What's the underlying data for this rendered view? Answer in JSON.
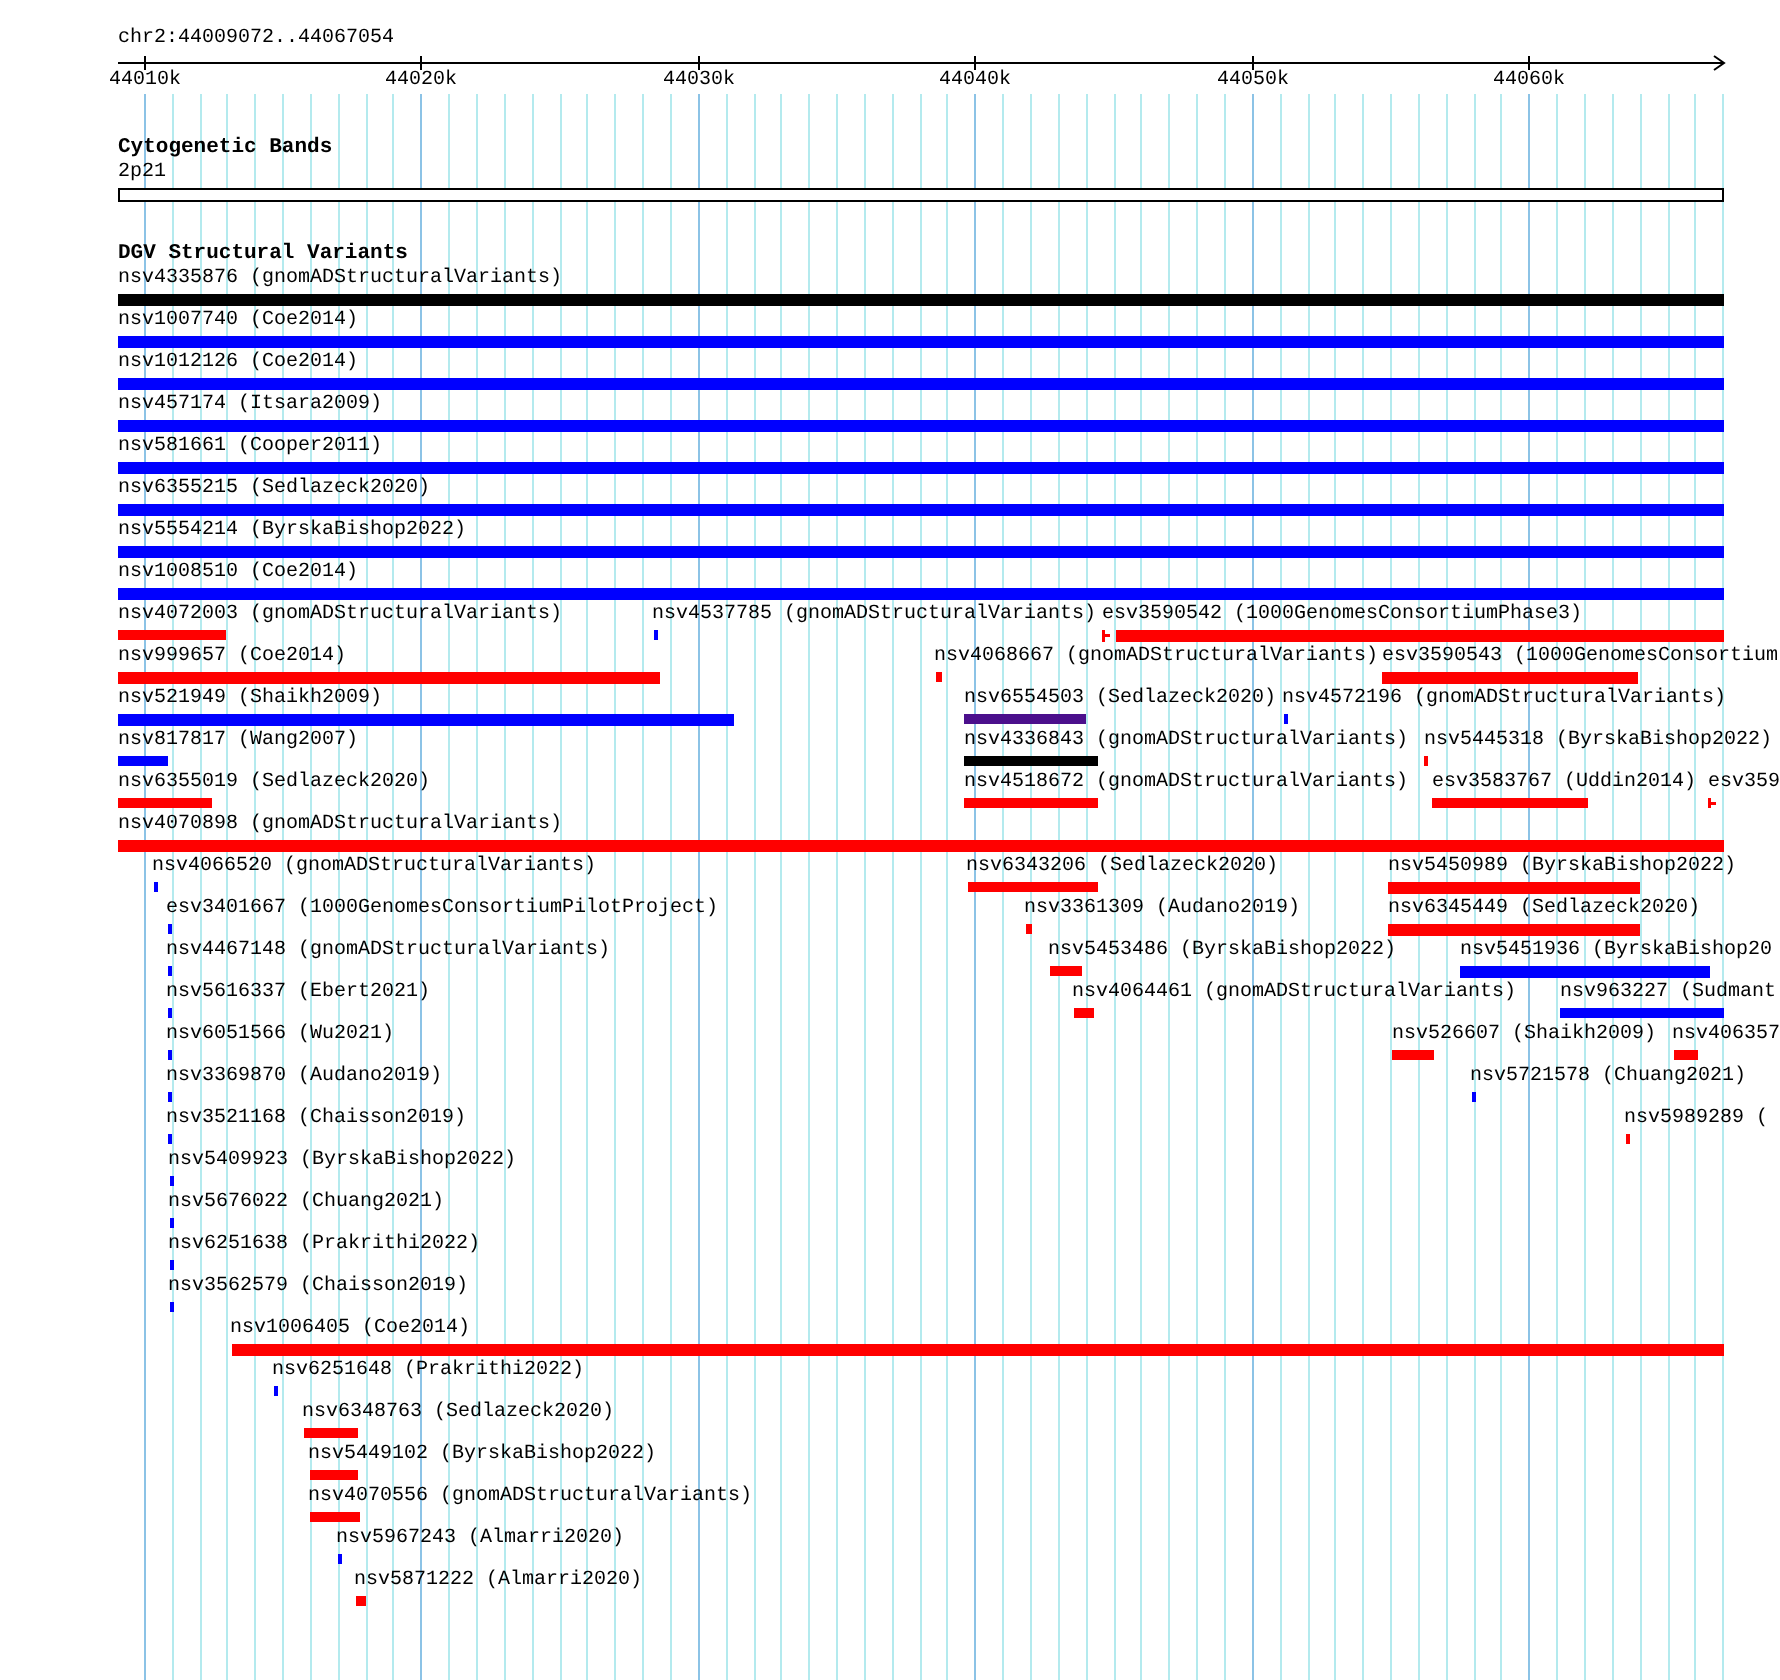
{
  "ruler": {
    "location": "chr2:44009072..44067054",
    "ticks": [
      "44010k",
      "44020k",
      "44030k",
      "44040k",
      "44050k",
      "44060k"
    ]
  },
  "tracks": [
    {
      "title": "Cytogenetic Bands",
      "rows": [
        {
          "features": [
            {
              "label": "2p21",
              "kind": "band"
            }
          ]
        }
      ]
    },
    {
      "title": "DGV Structural Variants",
      "rows": [
        {
          "features": [
            {
              "label": "nsv4335876 (gnomADStructuralVariants)",
              "color": "#000000",
              "kind": "bar"
            }
          ]
        },
        {
          "features": [
            {
              "label": "nsv1007740 (Coe2014)",
              "color": "#0000ff",
              "kind": "bar"
            }
          ]
        },
        {
          "features": [
            {
              "label": "nsv1012126 (Coe2014)",
              "color": "#0000ff",
              "kind": "bar"
            }
          ]
        },
        {
          "features": [
            {
              "label": "nsv457174 (Itsara2009)",
              "color": "#0000ff",
              "kind": "bar"
            }
          ]
        },
        {
          "features": [
            {
              "label": "nsv581661 (Cooper2011)",
              "color": "#0000ff",
              "kind": "bar"
            }
          ]
        },
        {
          "features": [
            {
              "label": "nsv6355215 (Sedlazeck2020)",
              "color": "#0000ff",
              "kind": "bar"
            }
          ]
        },
        {
          "features": [
            {
              "label": "nsv5554214 (ByrskaBishop2022)",
              "color": "#0000ff",
              "kind": "bar"
            }
          ]
        },
        {
          "features": [
            {
              "label": "nsv1008510 (Coe2014)",
              "color": "#0000ff",
              "kind": "bar"
            }
          ]
        },
        {
          "features": [
            {
              "label": "nsv4072003 (gnomADStructuralVariants)",
              "color": "#ff0000",
              "kind": "bar"
            },
            {
              "label": "nsv4537785 (gnomADStructuralVariants)",
              "color": "#0000ff",
              "kind": "bar"
            },
            {
              "label": "esv3590542 (1000GenomesConsortiumPhase3)",
              "color": "#ff0000",
              "kind": "split"
            }
          ]
        },
        {
          "features": [
            {
              "label": "nsv999657 (Coe2014)",
              "color": "#ff0000",
              "kind": "bar"
            },
            {
              "label": "nsv4068667 (gnomADStructuralVariants)",
              "color": "#ff0000",
              "kind": "bar"
            },
            {
              "label": "esv3590543 (1000GenomesConsortium",
              "color": "#ff0000",
              "kind": "bar"
            }
          ]
        },
        {
          "features": [
            {
              "label": "nsv521949 (Shaikh2009)",
              "color": "#0000ff",
              "kind": "bar"
            },
            {
              "label": "nsv6554503 (Sedlazeck2020)",
              "color": "#4b0f8c",
              "kind": "bar"
            },
            {
              "label": "nsv4572196 (gnomADStructuralVariants)",
              "color": "#0000ff",
              "kind": "bar"
            }
          ]
        },
        {
          "features": [
            {
              "label": "nsv817817 (Wang2007)",
              "color": "#0000ff",
              "kind": "bar"
            },
            {
              "label": "nsv4336843 (gnomADStructuralVariants)",
              "color": "#000000",
              "kind": "bar"
            },
            {
              "label": "nsv5445318 (ByrskaBishop2022)",
              "color": "#ff0000",
              "kind": "bar"
            }
          ]
        },
        {
          "features": [
            {
              "label": "nsv6355019 (Sedlazeck2020)",
              "color": "#ff0000",
              "kind": "bar"
            },
            {
              "label": "nsv4518672 (gnomADStructuralVariants)",
              "color": "#ff0000",
              "kind": "bar"
            },
            {
              "label": "esv3583767 (Uddin2014)",
              "color": "#ff0000",
              "kind": "bar"
            },
            {
              "label": "esv359",
              "color": "#ff0000",
              "kind": "split"
            }
          ]
        },
        {
          "features": [
            {
              "label": "nsv4070898 (gnomADStructuralVariants)",
              "color": "#ff0000",
              "kind": "bar"
            }
          ]
        },
        {
          "features": [
            {
              "label": "nsv4066520 (gnomADStructuralVariants)",
              "color": "#0000ff",
              "kind": "bar"
            },
            {
              "label": "nsv6343206 (Sedlazeck2020)",
              "color": "#ff0000",
              "kind": "bar"
            },
            {
              "label": "nsv5450989 (ByrskaBishop2022)",
              "color": "#ff0000",
              "kind": "bar"
            }
          ]
        },
        {
          "features": [
            {
              "label": "esv3401667 (1000GenomesConsortiumPilotProject)",
              "color": "#0000ff",
              "kind": "bar"
            },
            {
              "label": "nsv3361309 (Audano2019)",
              "color": "#ff0000",
              "kind": "bar"
            },
            {
              "label": "nsv6345449 (Sedlazeck2020)",
              "color": "#ff0000",
              "kind": "bar"
            }
          ]
        },
        {
          "features": [
            {
              "label": "nsv4467148 (gnomADStructuralVariants)",
              "color": "#0000ff",
              "kind": "bar"
            },
            {
              "label": "nsv5453486 (ByrskaBishop2022)",
              "color": "#ff0000",
              "kind": "bar"
            },
            {
              "label": "nsv5451936 (ByrskaBishop20",
              "color": "#0000ff",
              "kind": "bar"
            }
          ]
        },
        {
          "features": [
            {
              "label": "nsv5616337 (Ebert2021)",
              "color": "#0000ff",
              "kind": "bar"
            },
            {
              "label": "nsv4064461 (gnomADStructuralVariants)",
              "color": "#ff0000",
              "kind": "bar"
            },
            {
              "label": "nsv963227 (Sudmant",
              "color": "#0000ff",
              "kind": "bar"
            }
          ]
        },
        {
          "features": [
            {
              "label": "nsv6051566 (Wu2021)",
              "color": "#0000ff",
              "kind": "bar"
            },
            {
              "label": "nsv526607 (Shaikh2009)",
              "color": "#ff0000",
              "kind": "bar"
            },
            {
              "label": "nsv406357",
              "color": "#ff0000",
              "kind": "bar"
            }
          ]
        },
        {
          "features": [
            {
              "label": "nsv3369870 (Audano2019)",
              "color": "#0000ff",
              "kind": "bar"
            },
            {
              "label": "nsv5721578 (Chuang2021)",
              "color": "#0000ff",
              "kind": "bar"
            }
          ]
        },
        {
          "features": [
            {
              "label": "nsv3521168 (Chaisson2019)",
              "color": "#0000ff",
              "kind": "bar"
            },
            {
              "label": "nsv5989289 (",
              "color": "#ff0000",
              "kind": "bar"
            }
          ]
        },
        {
          "features": [
            {
              "label": "nsv5409923 (ByrskaBishop2022)",
              "color": "#0000ff",
              "kind": "bar"
            }
          ]
        },
        {
          "features": [
            {
              "label": "nsv5676022 (Chuang2021)",
              "color": "#0000ff",
              "kind": "bar"
            }
          ]
        },
        {
          "features": [
            {
              "label": "nsv6251638 (Prakrithi2022)",
              "color": "#0000ff",
              "kind": "bar"
            }
          ]
        },
        {
          "features": [
            {
              "label": "nsv3562579 (Chaisson2019)",
              "color": "#0000ff",
              "kind": "bar"
            }
          ]
        },
        {
          "features": [
            {
              "label": "nsv1006405 (Coe2014)",
              "color": "#ff0000",
              "kind": "bar"
            }
          ]
        },
        {
          "features": [
            {
              "label": "nsv6251648 (Prakrithi2022)",
              "color": "#0000ff",
              "kind": "bar"
            }
          ]
        },
        {
          "features": [
            {
              "label": "nsv6348763 (Sedlazeck2020)",
              "color": "#ff0000",
              "kind": "bar"
            }
          ]
        },
        {
          "features": [
            {
              "label": "nsv5449102 (ByrskaBishop2022)",
              "color": "#ff0000",
              "kind": "bar"
            }
          ]
        },
        {
          "features": [
            {
              "label": "nsv4070556 (gnomADStructuralVariants)",
              "color": "#ff0000",
              "kind": "bar"
            }
          ]
        },
        {
          "features": [
            {
              "label": "nsv5967243 (Almarri2020)",
              "color": "#0000ff",
              "kind": "bar"
            }
          ]
        },
        {
          "features": [
            {
              "label": "nsv5871222 (Almarri2020)",
              "color": "#ff0000",
              "kind": "bar"
            }
          ]
        }
      ]
    }
  ]
}
